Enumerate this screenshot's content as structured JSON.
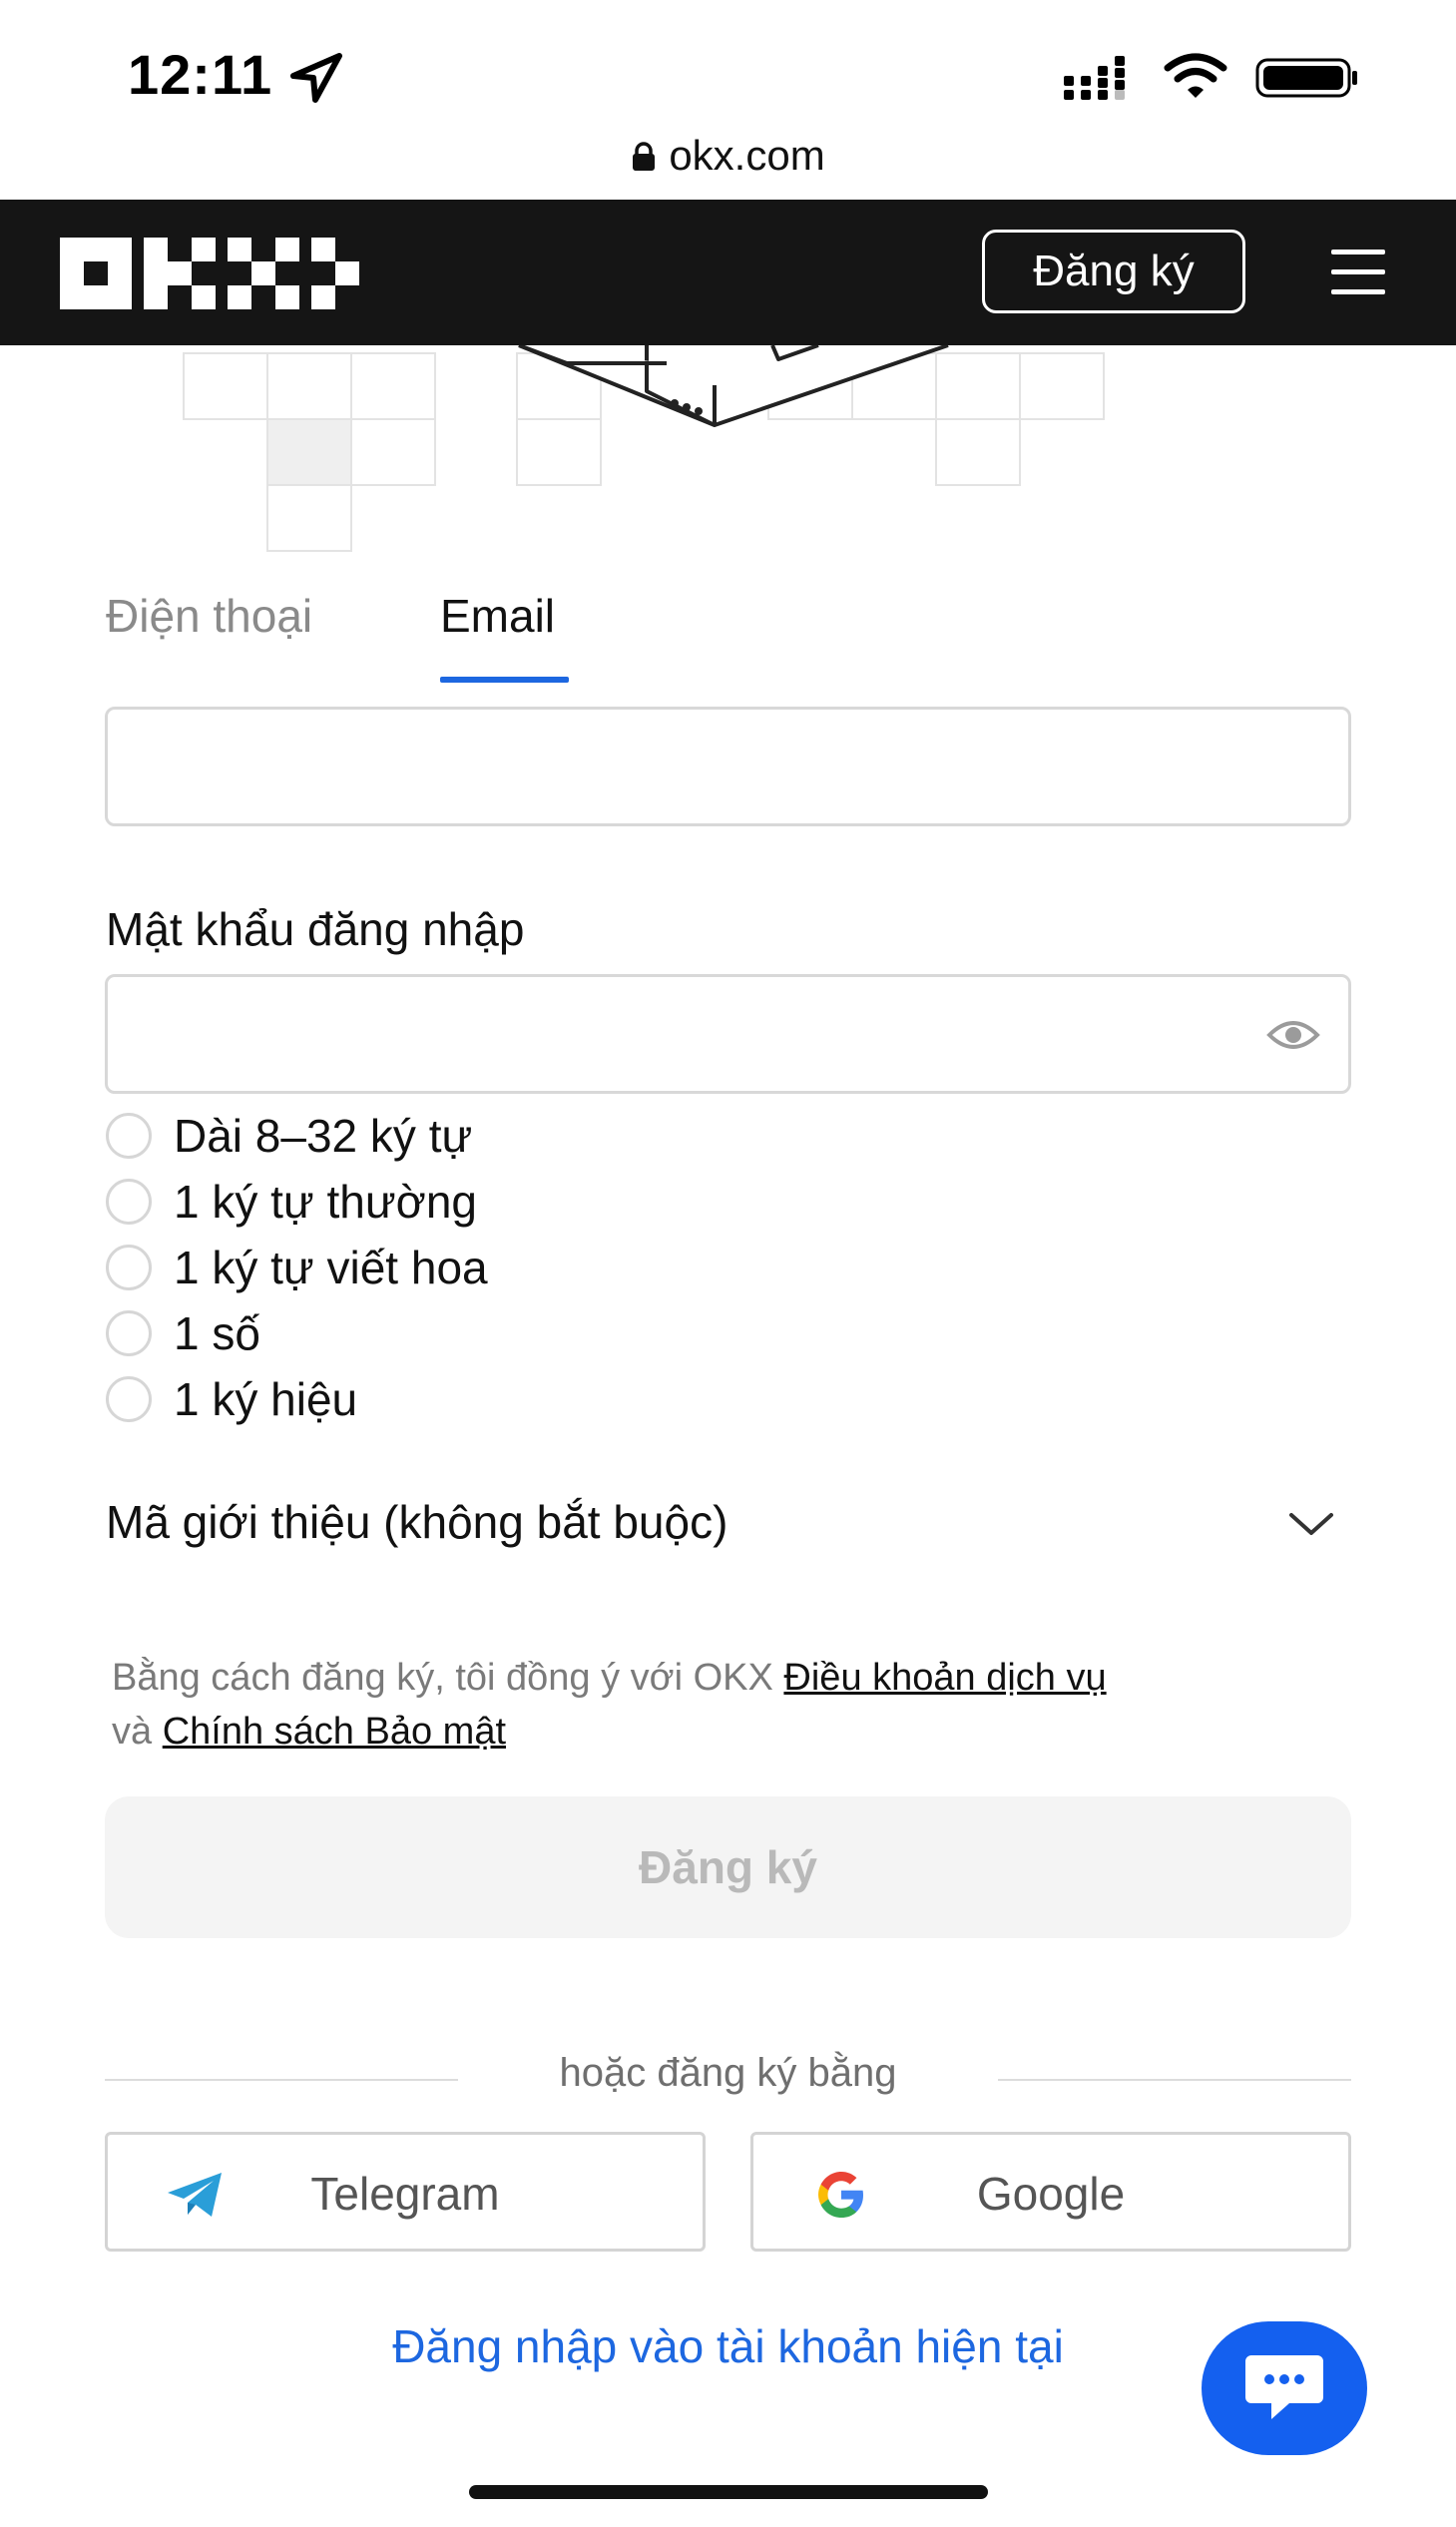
{
  "status_bar": {
    "time": "12:11"
  },
  "browser": {
    "url": "okx.com"
  },
  "header": {
    "signup_label": "Đăng ký"
  },
  "tabs": [
    {
      "label": "Điện thoại",
      "active": false
    },
    {
      "label": "Email",
      "active": true
    }
  ],
  "email_field": {
    "value": "",
    "placeholder": ""
  },
  "password": {
    "label": "Mật khẩu đăng nhập",
    "value": ""
  },
  "password_rules": [
    "Dài 8–32 ký tự",
    "1 ký tự thường",
    "1 ký tự viết hoa",
    "1 số",
    "1 ký hiệu"
  ],
  "referral": {
    "label": "Mã giới thiệu (không bắt buộc)"
  },
  "terms": {
    "prefix": "Bằng cách đăng ký, tôi đồng ý với OKX",
    "tos_link": "Điều khoản dịch vụ",
    "middle": "và",
    "privacy_link": "Chính sách Bảo mật"
  },
  "submit_label": "Đăng ký",
  "or_text": "hoặc đăng ký bằng",
  "social": {
    "telegram": "Telegram",
    "google": "Google"
  },
  "login_link": "Đăng nhập vào tài khoản hiện tại",
  "colors": {
    "accent": "#1d67e0",
    "header_bg": "#151515",
    "chat_bg": "#1460ef"
  },
  "icons": [
    "location-arrow-icon",
    "signal-icon",
    "wifi-icon",
    "battery-icon",
    "lock-icon",
    "okx-logo",
    "menu-icon",
    "eye-icon",
    "chevron-down-icon",
    "telegram-icon",
    "google-icon",
    "chat-icon"
  ]
}
